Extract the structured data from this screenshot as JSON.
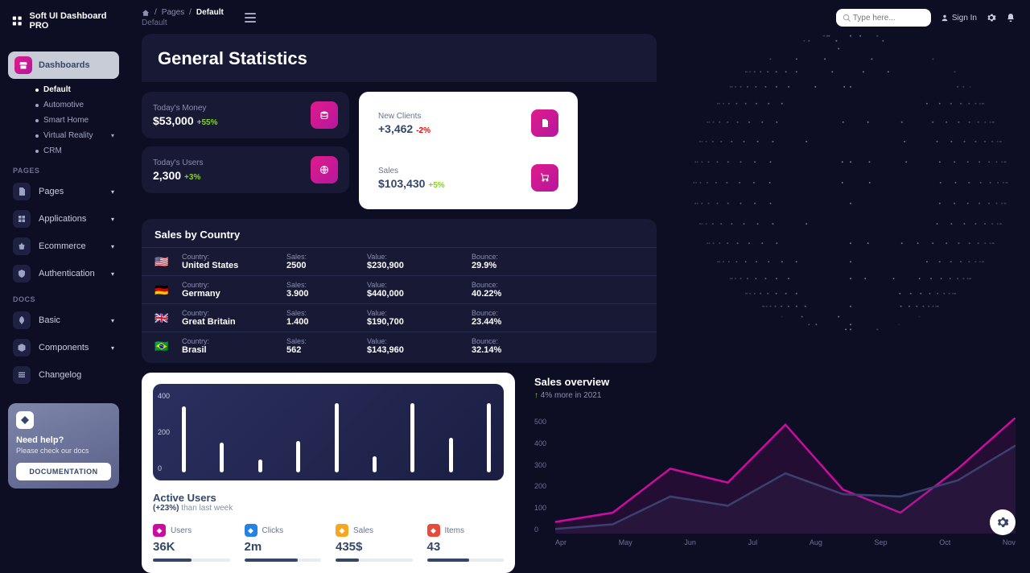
{
  "brand": "Soft UI Dashboard PRO",
  "breadcrumb": {
    "root": "Pages",
    "current": "Default",
    "sub": "Default"
  },
  "search": {
    "placeholder": "Type here..."
  },
  "signin": "Sign In",
  "nav": {
    "dashboards_label": "Dashboards",
    "dash_items": [
      "Default",
      "Automotive",
      "Smart Home",
      "Virtual Reality",
      "CRM"
    ],
    "pages_section": "PAGES",
    "items": [
      {
        "label": "Pages"
      },
      {
        "label": "Applications"
      },
      {
        "label": "Ecommerce"
      },
      {
        "label": "Authentication"
      }
    ],
    "docs_section": "DOCS",
    "docs": [
      {
        "label": "Basic"
      },
      {
        "label": "Components"
      },
      {
        "label": "Changelog"
      }
    ]
  },
  "help": {
    "title": "Need help?",
    "msg": "Please check our docs",
    "btn": "DOCUMENTATION"
  },
  "page_title": "General Statistics",
  "stats": {
    "money": {
      "label": "Today's Money",
      "value": "$53,000",
      "delta": "+55%",
      "pos": true
    },
    "users": {
      "label": "Today's Users",
      "value": "2,300",
      "delta": "+3%",
      "pos": true
    },
    "clients": {
      "label": "New Clients",
      "value": "+3,462",
      "delta": "-2%",
      "pos": false
    },
    "sales": {
      "label": "Sales",
      "value": "$103,430",
      "delta": "+5%",
      "pos": true
    }
  },
  "country": {
    "title": "Sales by Country",
    "headers": {
      "country": "Country:",
      "sales": "Sales:",
      "value": "Value:",
      "bounce": "Bounce:"
    },
    "rows": [
      {
        "flag": "🇺🇸",
        "name": "United States",
        "sales": "2500",
        "value": "$230,900",
        "bounce": "29.9%"
      },
      {
        "flag": "🇩🇪",
        "name": "Germany",
        "sales": "3.900",
        "value": "$440,000",
        "bounce": "40.22%"
      },
      {
        "flag": "🇬🇧",
        "name": "Great Britain",
        "sales": "1.400",
        "value": "$190,700",
        "bounce": "23.44%"
      },
      {
        "flag": "🇧🇷",
        "name": "Brasil",
        "sales": "562",
        "value": "$143,960",
        "bounce": "32.14%"
      }
    ]
  },
  "chart_data": {
    "bar": {
      "type": "bar",
      "ylabels": [
        "400",
        "200",
        "0"
      ],
      "values": [
        400,
        180,
        80,
        190,
        420,
        100,
        420,
        210,
        420
      ],
      "ylim": [
        0,
        500
      ]
    },
    "line": {
      "type": "line",
      "title": "Sales overview",
      "subtitle": "4% more in 2021",
      "ylabels": [
        "500",
        "400",
        "300",
        "200",
        "100",
        "0"
      ],
      "ylim": [
        0,
        500
      ],
      "x": [
        "Apr",
        "May",
        "Jun",
        "Jul",
        "Aug",
        "Sep",
        "Oct",
        "Nov"
      ],
      "series": [
        {
          "name": "series-a",
          "color": "#cb0c9f",
          "values": [
            50,
            90,
            280,
            220,
            470,
            190,
            90,
            280,
            500
          ]
        },
        {
          "name": "series-b",
          "color": "#3a416f",
          "values": [
            20,
            40,
            160,
            120,
            260,
            170,
            160,
            230,
            380
          ]
        }
      ]
    }
  },
  "active_users": {
    "title": "Active Users",
    "sub_bold": "(+23%)",
    "sub_rest": " than last week",
    "metrics": [
      {
        "label": "Users",
        "value": "36K",
        "color": "#cb0c9f",
        "fill": 50
      },
      {
        "label": "Clicks",
        "value": "2m",
        "color": "#2781e0",
        "fill": 70
      },
      {
        "label": "Sales",
        "value": "435$",
        "color": "#f5a623",
        "fill": 30
      },
      {
        "label": "Items",
        "value": "43",
        "color": "#ea4a3b",
        "fill": 55
      }
    ]
  }
}
